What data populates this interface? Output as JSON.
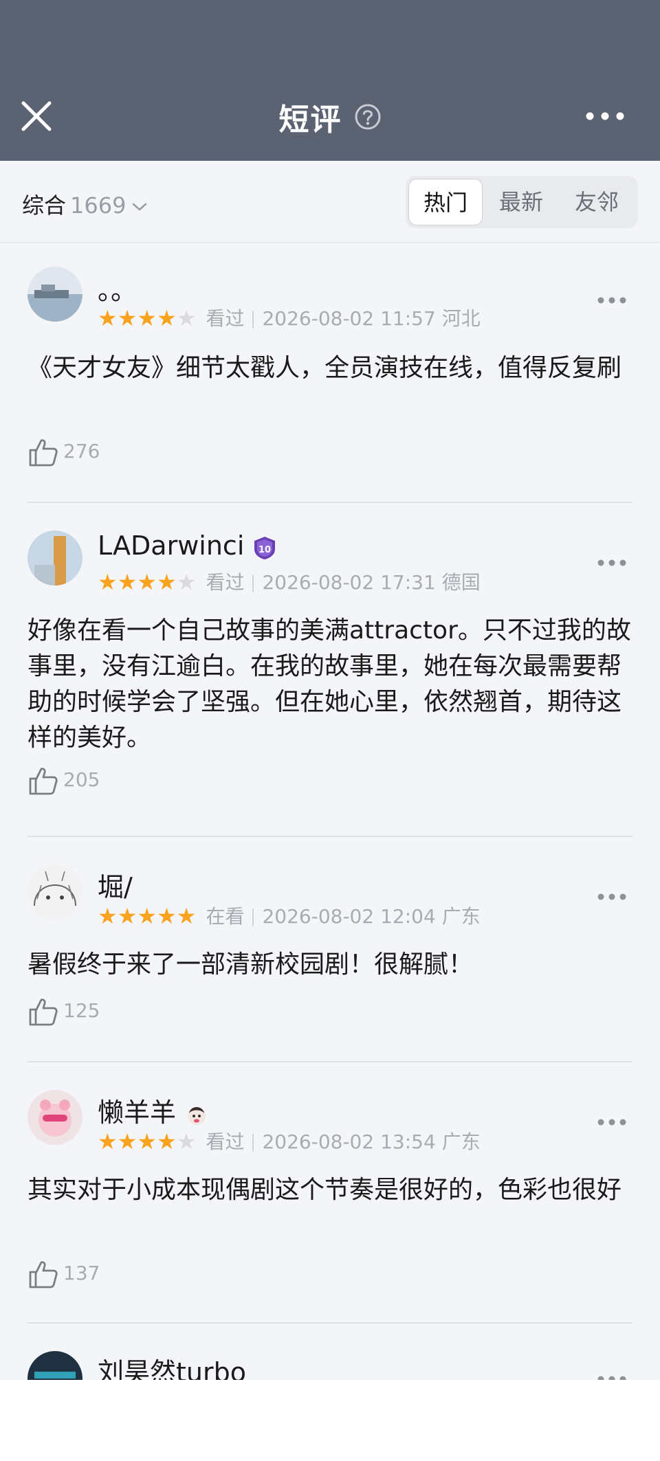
{
  "header": {
    "title": "短评",
    "bg_color": "#5b6271",
    "icons": {
      "close": "close-icon",
      "help": "question-circle-icon",
      "more": "more-dots-icon"
    }
  },
  "filter": {
    "sort_label": "综合",
    "count": "1669",
    "tabs": [
      "热门",
      "最新",
      "友邻"
    ],
    "active_tab": "热门"
  },
  "star_color": "#f8a21d",
  "reviews": [
    {
      "name": "。。",
      "stars": 4,
      "status": "看过",
      "time": "2026-08-02 11:57",
      "location": "河北",
      "text": "《天才女友》细节太戳人，全员演技在线，值得反复刷",
      "likes": "276"
    },
    {
      "name": "LADarwinci",
      "badge_level": "10",
      "stars": 4,
      "status": "看过",
      "time": "2026-08-02 17:31",
      "location": "德国",
      "text": "好像在看一个自己故事的美满attractor。只不过我的故事里，没有江逾白。在我的故事里，她在每次最需要帮助的时候学会了坚强。但在她心里，依然翘首，期待这样的美好。",
      "likes": "205"
    },
    {
      "name": "堀/",
      "stars": 5,
      "status": "在看",
      "time": "2026-08-02 12:04",
      "location": "广东",
      "text": "暑假终于来了一部清新校园剧！很解腻！",
      "likes": "125"
    },
    {
      "name": "懒羊羊",
      "stars": 4,
      "status": "看过",
      "time": "2026-08-02 13:54",
      "location": "广东",
      "text": "其实对于小成本现偶剧这个节奏是很好的，色彩也很好",
      "likes": "137"
    },
    {
      "name": "刘昊然turbo"
    }
  ]
}
